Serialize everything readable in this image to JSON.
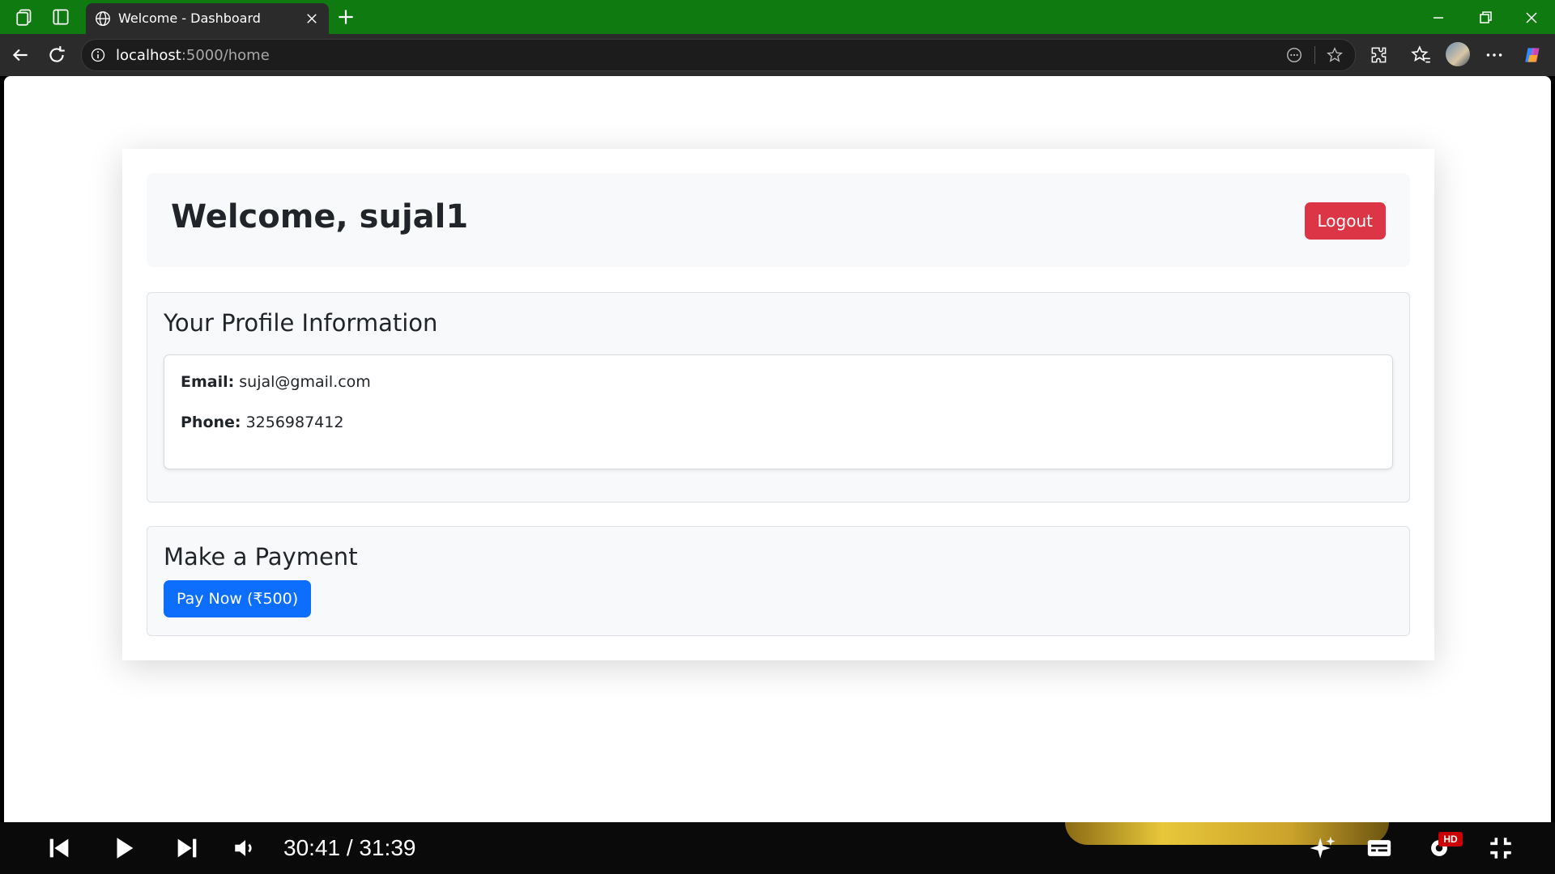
{
  "browser": {
    "tab_title": "Welcome - Dashboard",
    "url_host": "localhost",
    "url_path": ":5000/home"
  },
  "page": {
    "welcome_text": "Welcome, sujal1",
    "logout_label": "Logout",
    "profile": {
      "heading": "Your Profile Information",
      "email_label": "Email:",
      "email_value": "sujal@gmail.com",
      "phone_label": "Phone:",
      "phone_value": "3256987412"
    },
    "payment": {
      "heading": "Make a Payment",
      "button_label": "Pay Now (₹500)"
    }
  },
  "player": {
    "timecode": "30:41 / 31:39",
    "hd_badge": "HD"
  },
  "colors": {
    "titlebar": "#0f7a10",
    "logout": "#dc3545",
    "pay": "#0d6efd"
  }
}
